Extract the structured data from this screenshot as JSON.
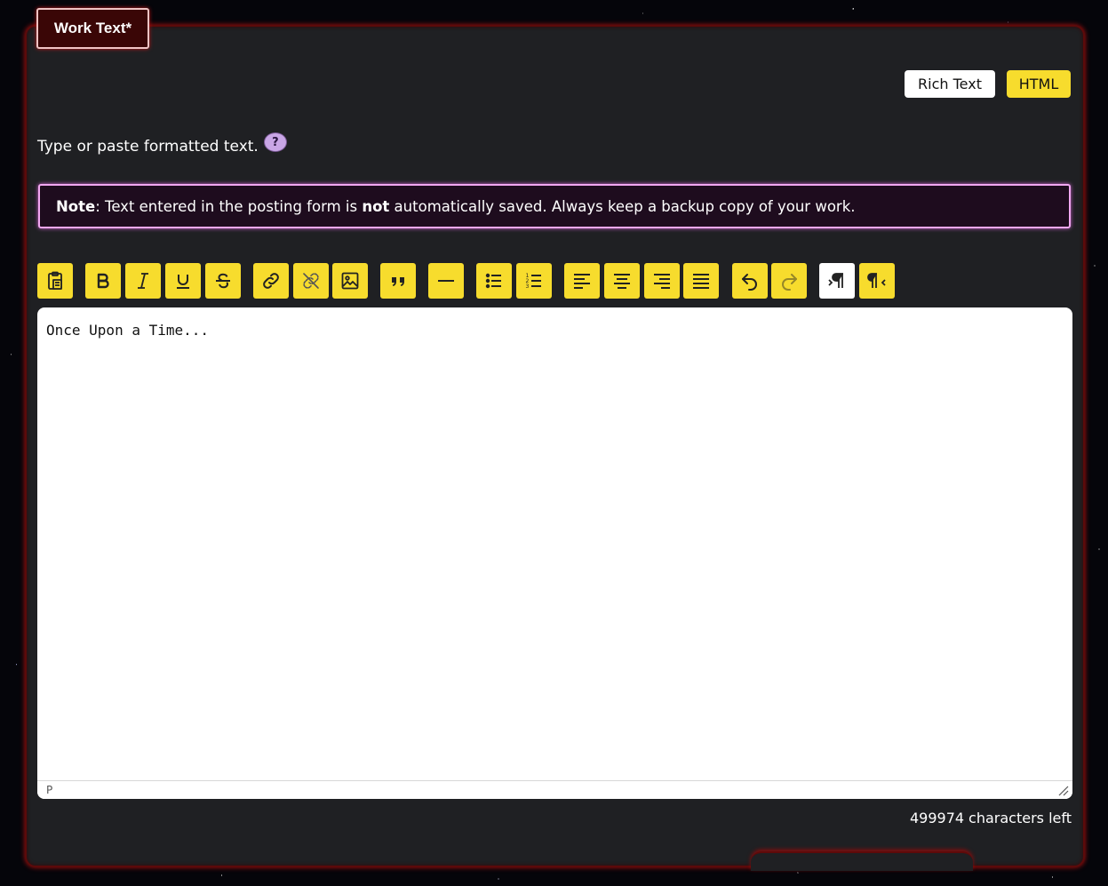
{
  "section_tab": {
    "label": "Work Text*"
  },
  "editor_mode": {
    "rich_text_label": "Rich Text",
    "html_label": "HTML",
    "active": "HTML"
  },
  "instructions": {
    "text": "Type or paste formatted text.",
    "help_label": "?"
  },
  "notice": {
    "note_label": "Note",
    "text_before": ": Text entered in the posting form is ",
    "emphasis": "not",
    "text_after": " automatically saved. Always keep a backup copy of your work."
  },
  "toolbar": {
    "buttons": [
      {
        "name": "paste-button",
        "icon": "clipboard-icon"
      },
      {
        "name": "bold-button",
        "icon": "bold-icon"
      },
      {
        "name": "italic-button",
        "icon": "italic-icon"
      },
      {
        "name": "underline-button",
        "icon": "underline-icon"
      },
      {
        "name": "strikethrough-button",
        "icon": "strikethrough-icon"
      },
      {
        "name": "insert-link-button",
        "icon": "link-icon"
      },
      {
        "name": "remove-link-button",
        "icon": "unlink-icon"
      },
      {
        "name": "insert-image-button",
        "icon": "image-icon"
      },
      {
        "name": "blockquote-button",
        "icon": "quote-icon"
      },
      {
        "name": "horizontal-rule-button",
        "icon": "horizontal-line-icon"
      },
      {
        "name": "bulleted-list-button",
        "icon": "bullet-list-icon"
      },
      {
        "name": "numbered-list-button",
        "icon": "numbered-list-icon"
      },
      {
        "name": "align-left-button",
        "icon": "align-left-icon"
      },
      {
        "name": "align-center-button",
        "icon": "align-center-icon"
      },
      {
        "name": "align-right-button",
        "icon": "align-right-icon"
      },
      {
        "name": "justify-button",
        "icon": "justify-icon"
      },
      {
        "name": "undo-button",
        "icon": "undo-icon"
      },
      {
        "name": "redo-button",
        "icon": "redo-icon",
        "disabled": true
      },
      {
        "name": "left-to-right-button",
        "icon": "ltr-paragraph-icon",
        "active": true
      },
      {
        "name": "right-to-left-button",
        "icon": "rtl-paragraph-icon"
      }
    ]
  },
  "editor": {
    "content": "Once Upon a Time...",
    "status_path": "P"
  },
  "counter": {
    "value": "499974",
    "suffix": "characters left"
  },
  "colors": {
    "accent": "#f7dc2d",
    "panel": "#1f2023",
    "panel_border": "#5c0a0a",
    "notice_border": "#f1a7f1"
  }
}
